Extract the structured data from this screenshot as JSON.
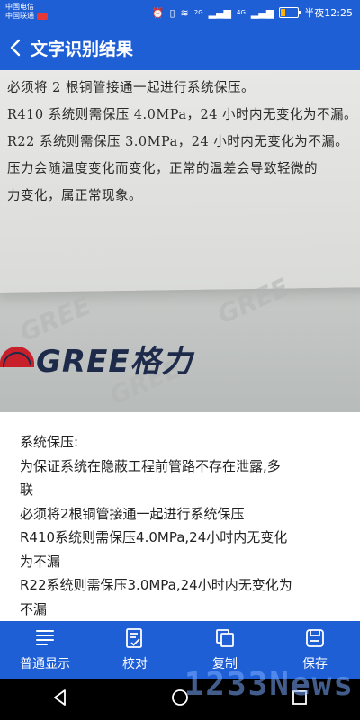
{
  "status_bar": {
    "carrier_1": "中国电信",
    "carrier_2": "中国联通",
    "network_1": "2G",
    "network_2": "4G",
    "time": "半夜12:25"
  },
  "app_bar": {
    "title": "文字识别结果",
    "back_icon": "chevron-left-icon"
  },
  "photo": {
    "lines": [
      "必须将 2 根铜管接通一起进行系统保压。",
      "R410 系统则需保压 4.0MPa，24 小时内无变化为不漏。",
      "R22 系统则需保压 3.0MPa，24 小时内无变化为不漏。",
      "压力会随温度变化而变化，正常的温差会导致轻微的",
      "力变化，属正常现象。"
    ],
    "brand": "GREE格力"
  },
  "result": {
    "lines": [
      "系统保压:",
      "为保证系统在隐蔽工程前管路不存在泄露,多",
      "联",
      "必须将2根铜管接通一起进行系统保压",
      "R410系统则需保压4.0MPa,24小时内无变化",
      "为不漏",
      "R22系统则需保压3.0MPa,24小时内无变化为",
      "不漏"
    ]
  },
  "toolbar": {
    "items": [
      {
        "label": "普通显示",
        "icon": "list-lines-icon"
      },
      {
        "label": "校对",
        "icon": "edit-check-icon"
      },
      {
        "label": "复制",
        "icon": "copy-icon"
      },
      {
        "label": "保存",
        "icon": "save-icon"
      }
    ]
  },
  "watermark": "1233News",
  "colors": {
    "primary": "#1f5fd6",
    "result_bg": "#ffffff"
  }
}
